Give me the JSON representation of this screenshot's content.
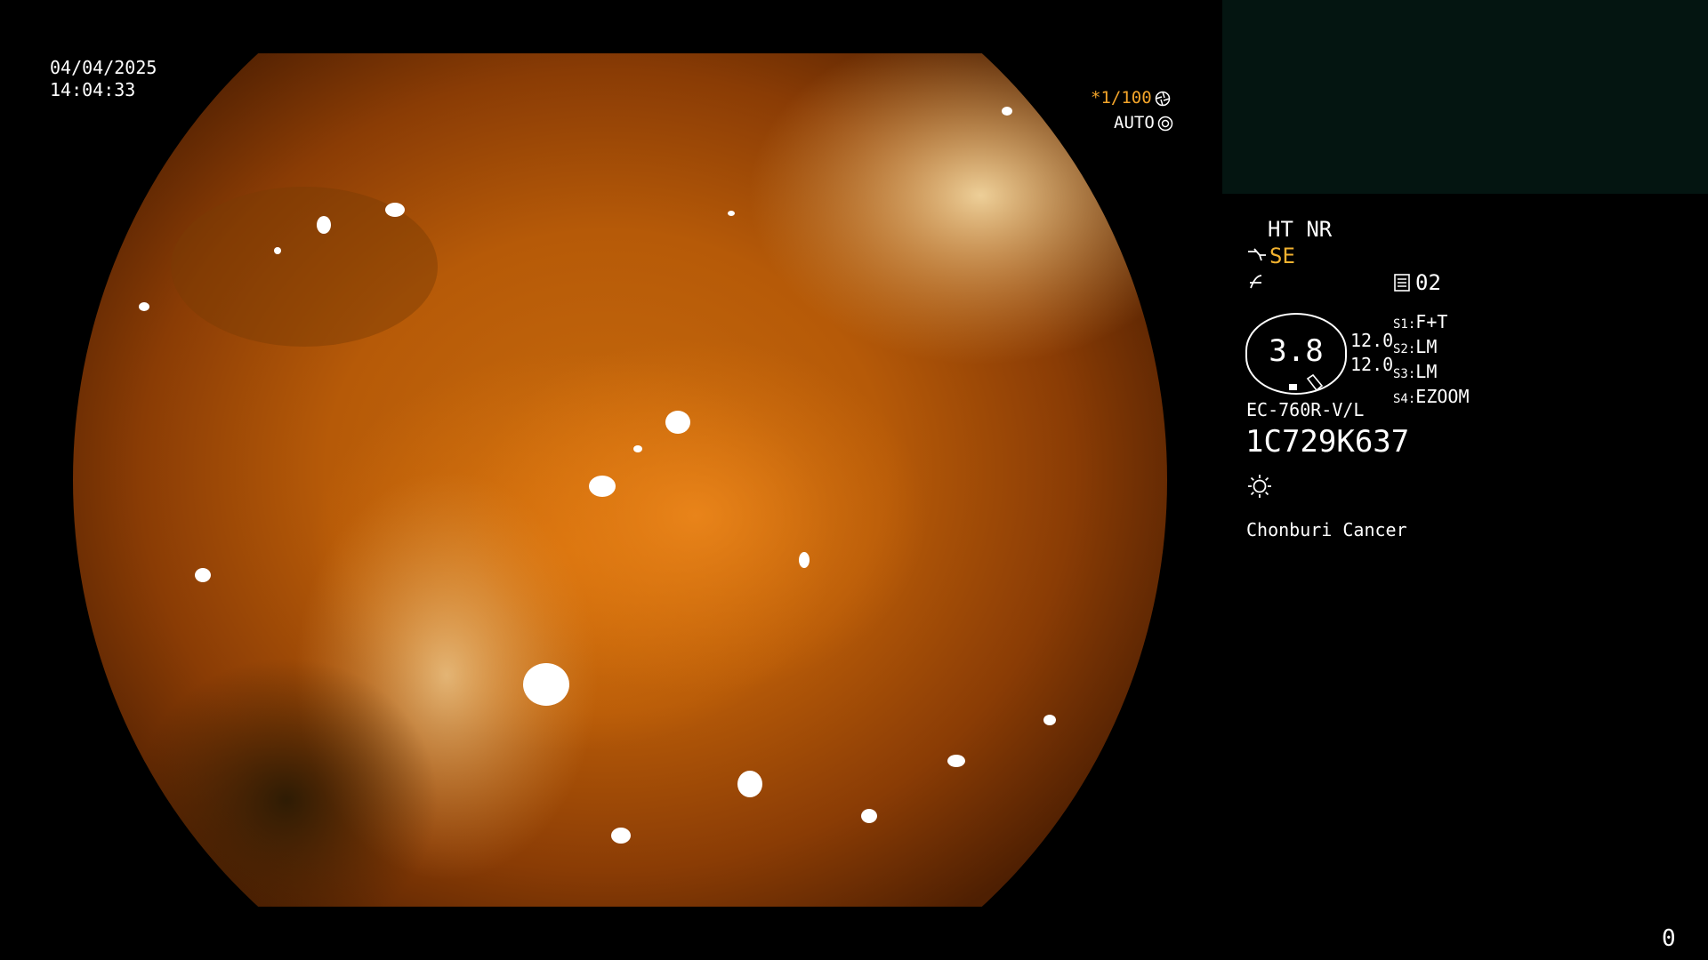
{
  "datetime": {
    "date": "04/04/2025",
    "time": "14:04:33"
  },
  "capture": {
    "shutter": "*1/100",
    "shutter_color": "#f4a52a",
    "mode": "AUTO"
  },
  "settings": {
    "ht_nr": "HT NR",
    "se": "SE",
    "se_color": "#f2b22f",
    "page": "02",
    "zoom_value": "3.8",
    "value_a": "12.0",
    "value_b": "12.0",
    "s1_key": "S1:",
    "s1_val": "F+T",
    "s2_key": "S2:",
    "s2_val": "LM",
    "s3_key": "S3:",
    "s3_val": "LM",
    "s4_key": "S4:",
    "s4_val": "EZOOM"
  },
  "scope": {
    "model": "EC-760R-V/L",
    "serial": "1C729K637"
  },
  "institution": "Chonburi Cancer",
  "counter": "0",
  "icons": {
    "shutter": "aperture-icon",
    "mode": "iris-icon",
    "se": "scope-tip-icon",
    "ht": "filter-icon",
    "page": "memo-icon",
    "light": "light-icon"
  },
  "colors": {
    "tissue": "#c76a0d",
    "background": "#000000",
    "thumb_panel": "#041511"
  }
}
